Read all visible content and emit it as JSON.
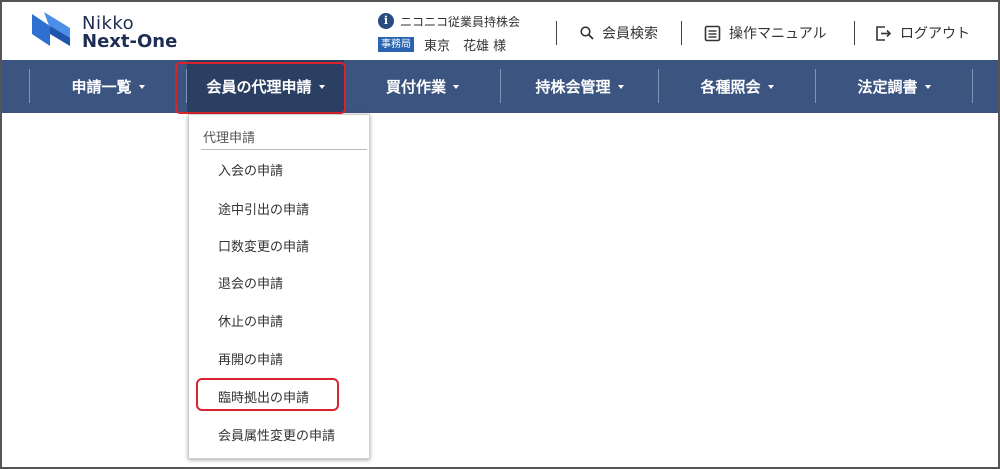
{
  "logo": {
    "line1": "Nikko",
    "line2": "Next-One"
  },
  "header": {
    "company_name": "ニコニコ従業員持株会",
    "role_badge": "事務局",
    "user_name": "東京　花雄 様",
    "member_search": "会員検索",
    "manual": "操作マニュアル",
    "logout": "ログアウト"
  },
  "nav": {
    "items": [
      {
        "label": "申請一覧"
      },
      {
        "label": "会員の代理申請"
      },
      {
        "label": "買付作業"
      },
      {
        "label": "持株会管理"
      },
      {
        "label": "各種照会"
      },
      {
        "label": "法定調書"
      }
    ],
    "active_index": 1
  },
  "dropdown": {
    "header": "代理申請",
    "items": [
      {
        "label": "入会の申請"
      },
      {
        "label": "途中引出の申請"
      },
      {
        "label": "口数変更の申請"
      },
      {
        "label": "退会の申請"
      },
      {
        "label": "休止の申請"
      },
      {
        "label": "再開の申請"
      },
      {
        "label": "臨時拠出の申請"
      },
      {
        "label": "会員属性変更の申請"
      }
    ],
    "highlighted_index": 6
  },
  "colors": {
    "nav_bg": "#3b5480",
    "nav_active_bg": "#2b3f63",
    "highlight": "#d9232d",
    "logo_blue": "#2f6fd0",
    "badge_blue": "#2a63b0"
  }
}
